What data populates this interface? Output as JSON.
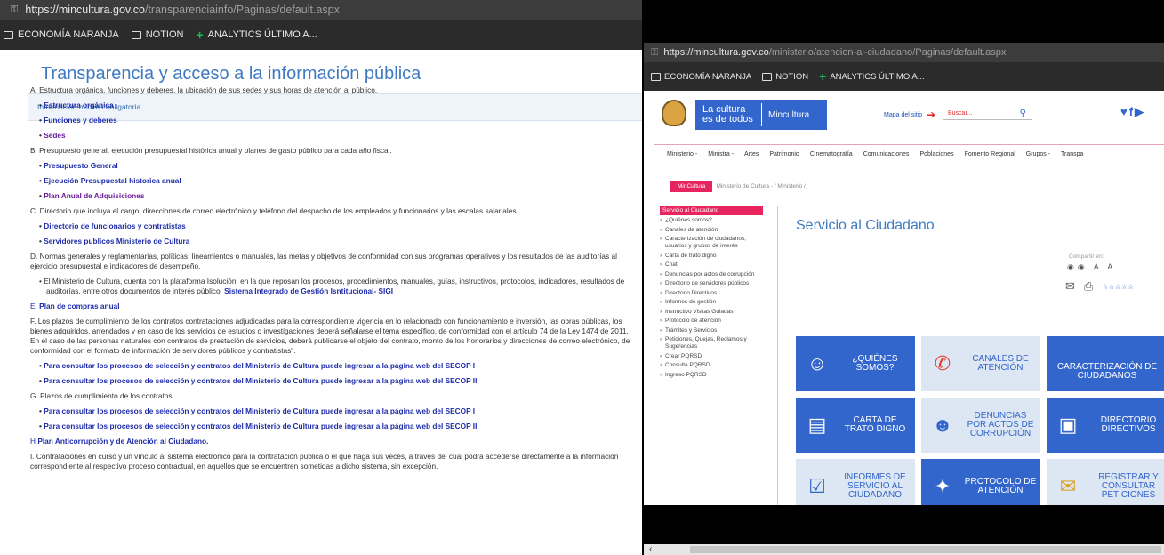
{
  "left": {
    "url_host": "https://mincultura.gov.co",
    "url_path": "/transparenciainfo/Paginas/default.aspx",
    "bookmarks": [
      "ECONOMÍA NARANJA",
      "NOTION",
      "ANALYTICS ÚLTIMO A..."
    ],
    "page_title": "Transparencia y acceso a la información pública",
    "box_header": "Información mínima obligatoria",
    "a_text": "A. Estructura orgánica, funciones y deberes, la ubicación de sus sedes y sus horas de atención al público.",
    "a_links": [
      "Estructura orgánica",
      "Funciones y deberes",
      "Sedes"
    ],
    "b_text": "B. Presupuesto general, ejecución presupuestal histórica anual y planes de gasto público para cada año fiscal.",
    "b_links": [
      "Presupuesto General",
      "Ejecución Presupuestal historica anual",
      "Plan Anual de Adquisiciones"
    ],
    "c_text": "C. Directorio que incluya el cargo, direcciones de correo electrónico y teléfono del despacho de los empleados y funcionarios y las escalas salariales.",
    "c_links": [
      "Directorio de funcionarios y contratistas",
      "Servidores publicos Ministerio de Cultura"
    ],
    "d_text": "D. Normas generales y reglamentarias, políticas, lineamientos o manuales, las metas y objetivos de conformidad con sus programas operativos y los resultados de las auditorías al ejercicio presupuestal e indicadores de desempeño.",
    "d_bullet": "El Ministerio de Cultura, cuenta con la plataforma Isolución, en la que reposan los procesos, procedimientos, manuales, guías, instructivos, protocolos, indicadores, resultados de auditorías, entre otros documentos de interés público.",
    "d_link": "Sistema Integrado de Gestión Isntitucional- SIGI",
    "e_prefix": "E.",
    "e_link": "Plan de compras anual",
    "f_text": "F. Los plazos de cumplimiento de los contratos contrataciones adjudicadas para la correspondiente vigencia en lo relacionado con funcionamiento e inversión, las obras públicas, los bienes adquiridos, arrendados y en caso de los servicios de estudios o investigaciones deberá señalarse el tema específico, de conformidad con el artículo 74 de la Ley 1474 de 2011. En el caso de las personas naturales con contratos de prestación de servicios, deberá publicarse el objeto del contrato, monto de los honorarios y direcciones de correo electrónico, de conformidad con el formato de información de servidores públicos y contratistas\".",
    "secop_links": [
      "Para consultar los procesos de selección y contratos del Ministerio de Cultura puede ingresar a la página web del SECOP I",
      "Para consultar los procesos de selección y contratos del Ministerio de Cultura puede ingresar a la página web del SECOP II"
    ],
    "g_text": "G. Plazos de cumplimiento de los contratos.",
    "h_prefix": "H",
    "h_link": "Plan Anticorrupción y de Atención al Ciudadano.",
    "i_text": "I. Contrataciones en curso y un vínculo al sistema electrónico para la contratación pública o el que haga sus veces, a través del cual podrá accederse directamente a la información correspondiente al respectivo proceso contractual, en aquellos que se encuentren sometidas a dicho sistema, sin excepción."
  },
  "right": {
    "url_host": "https://mincultura.gov.co",
    "url_path": "/ministerio/atencion-al-ciudadano/Paginas/default.aspx",
    "bookmarks": [
      "ECONOMÍA NARANJA",
      "NOTION",
      "ANALYTICS ÚLTIMO A..."
    ],
    "brand_line1": "La cultura",
    "brand_line2": "es de todos",
    "brand_name": "Mincultura",
    "sitemap": "Mapa del sitio",
    "search_placeholder": "Buscar...",
    "nav": [
      "Ministerio -",
      "Ministra -",
      "Artes",
      "Patrimonio",
      "Cinematografía",
      "Comunicaciones",
      "Poblaciones",
      "Fomento Regional",
      "Grupos -",
      "Transpa"
    ],
    "crumb_tag": "MinCultura",
    "crumb_path": "Ministerio de Cultura - / Ministerio /",
    "side_header": "Servicio al Ciudadano",
    "side_items": [
      "¿Quiénes somos?",
      "Canales de atención",
      "Caracterización de ciudadanos, usuarios y grupos de interés",
      "Carta de trato digno",
      "Chat",
      "Denuncias por actos de corrupción",
      "Directorio de servidores públicos",
      "Directorio Directivos",
      "Informes de gestión",
      "Instructivo Visitas Guiadas",
      "Protocolo de atención",
      "Trámites y Servicios",
      "Peticiones, Quejas, Reclamos y Sugerencias",
      "Crear PQRSD",
      "Consulta PQRSD",
      "Ingreso PQRSD"
    ],
    "section_title": "Servicio al Ciudadano",
    "share_label": "Compartir en:",
    "tiles": [
      "¿QUIÉNES SOMOS?",
      "CANALES DE ATENCIÓN",
      "CARACTERIZACIÓN DE CIUDADANOS",
      "CARTA DE TRATO DIGNO",
      "DENUNCIAS POR ACTOS DE CORRUPCIÓN",
      "DIRECTORIO DIRECTIVOS",
      "INFORMES DE SERVICIO AL CIUDADANO",
      "PROTOCOLO DE ATENCIÓN",
      "REGISTRAR Y CONSULTAR PETICIONES"
    ]
  }
}
